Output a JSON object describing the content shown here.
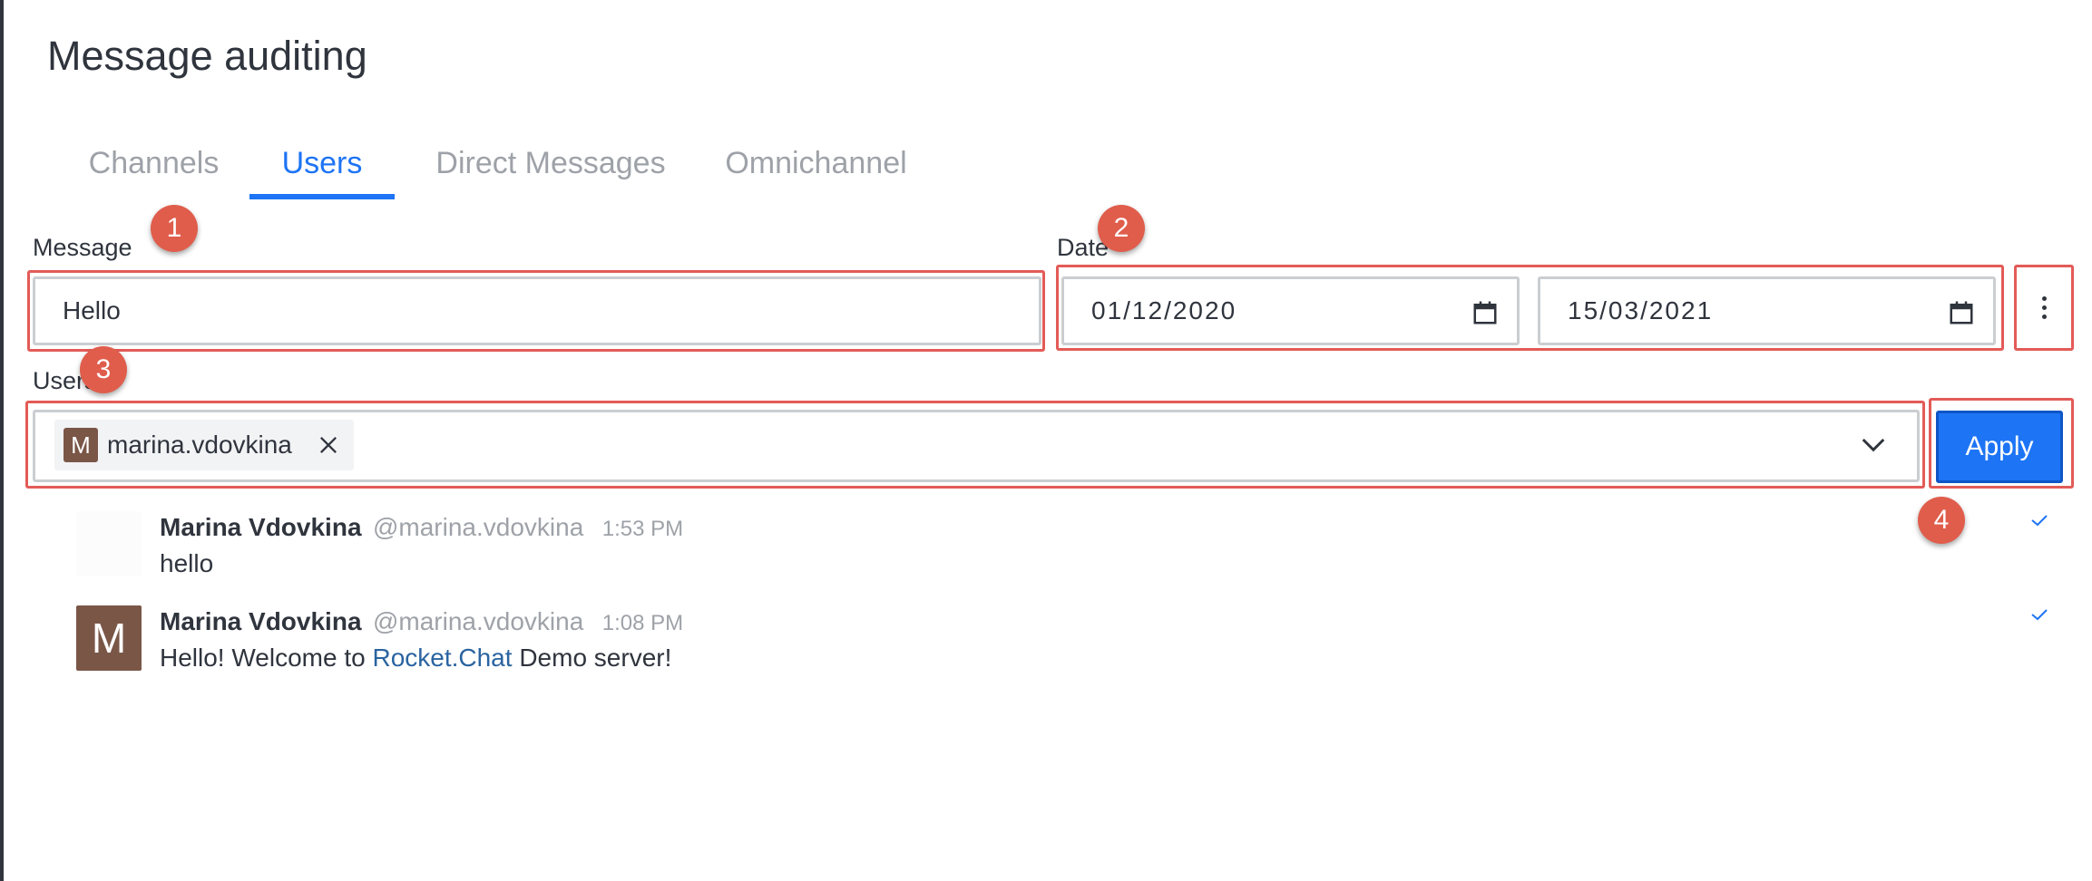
{
  "page": {
    "title": "Message auditing"
  },
  "tabs": [
    {
      "label": "Channels"
    },
    {
      "label": "Users"
    },
    {
      "label": "Direct Messages"
    },
    {
      "label": "Omnichannel"
    }
  ],
  "active_tab": "Users",
  "filters": {
    "message_label": "Message",
    "message_value": "Hello",
    "date_label": "Date",
    "date_start": "01/12/2020",
    "date_end": "15/03/2021",
    "users_label": "Users",
    "selected_user": {
      "initial": "M",
      "username": "marina.vdovkina"
    },
    "apply_label": "Apply"
  },
  "annotations": [
    "1",
    "2",
    "3",
    "4"
  ],
  "messages": [
    {
      "name": "Marina Vdovkina",
      "username": "@marina.vdovkina",
      "time": "1:53 PM",
      "text": "hello"
    },
    {
      "name": "Marina Vdovkina",
      "username": "@marina.vdovkina",
      "time": "1:08 PM",
      "avatar_initial": "M",
      "text_before": "Hello! Welcome to ",
      "link_text": "Rocket.Chat",
      "text_after": " Demo server!"
    }
  ],
  "colors": {
    "accent": "#1d74f5",
    "annotation": "#e05d4c",
    "avatar": "#7a5647"
  },
  "icons": [
    "calendar-icon",
    "kebab-menu-icon",
    "close-icon",
    "chevron-down-icon",
    "check-icon"
  ]
}
